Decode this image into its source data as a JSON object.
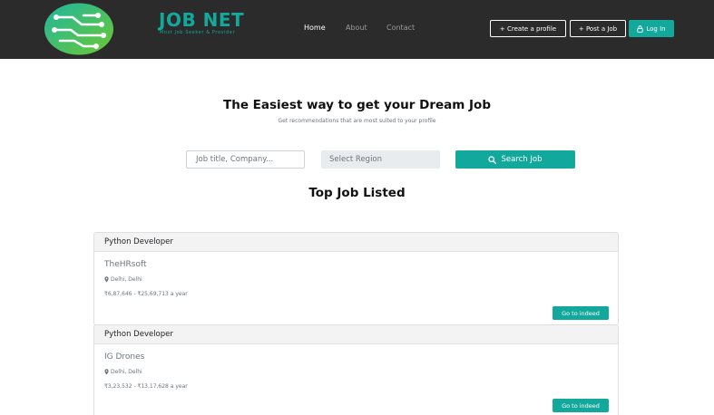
{
  "brand": {
    "title": "JOB NET",
    "tagline": "Most Job Seeker & Provider",
    "logo_icon": "circuit-logo-icon"
  },
  "nav": {
    "links": [
      {
        "label": "Home",
        "active": true
      },
      {
        "label": "About",
        "active": false
      },
      {
        "label": "Contact",
        "active": false
      }
    ],
    "create_profile": "+ Create a profile",
    "post_job": "+ Post a Job",
    "login": "Log In",
    "login_icon": "lock-icon"
  },
  "hero": {
    "title": "The Easiest way to get your Dream Job",
    "subtitle": "Get recommendations that are most suited to your profile"
  },
  "search": {
    "job_placeholder": "Job title, Company...",
    "region_placeholder": "Select Region",
    "button_label": "Search Job",
    "button_icon": "search-icon"
  },
  "listing_title": "Top Job Listed",
  "jobs": [
    {
      "title": "Python Developer",
      "company": "TheHRsoft",
      "location": "Delhi, Delhi",
      "salary": "₹6,87,646 - ₹25,69,713 a year",
      "button": "Go to indeed"
    },
    {
      "title": "Python Developer",
      "company": "IG Drones",
      "location": "Delhi, Delhi",
      "salary": "₹3,23,532 - ₹13,17,628 a year",
      "button": "Go to indeed"
    }
  ],
  "colors": {
    "accent": "#12a89b",
    "navbar": "#2b2b2b",
    "logo_green": "#3cc06a"
  }
}
